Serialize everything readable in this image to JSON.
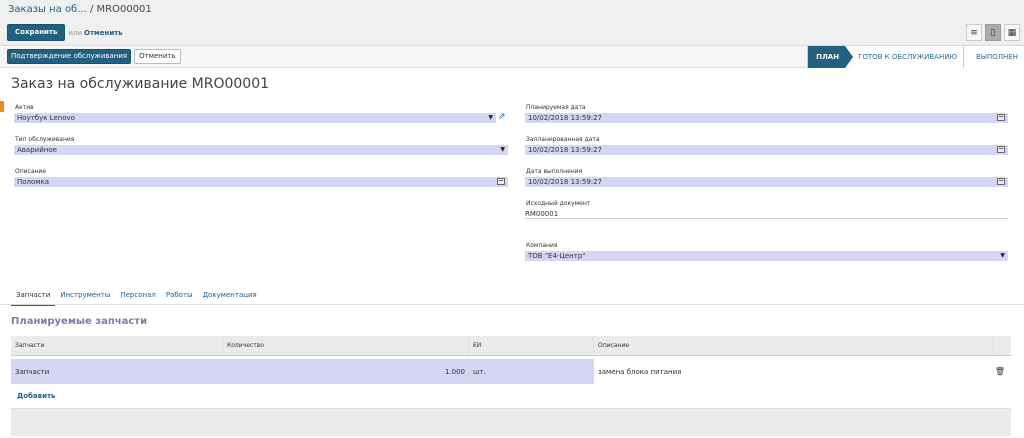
{
  "breadcrumb": {
    "parent": "Заказы на об...",
    "separator": "/",
    "current": "MRO00001"
  },
  "toolbar": {
    "save_label": "Сохранить",
    "or_label": "или",
    "cancel_label": "Отменить"
  },
  "views": [
    "list-view-icon",
    "form-view-icon",
    "calendar-view-icon"
  ],
  "header": {
    "confirm_label": "Подтверждение обслуживания",
    "cancel_label": "Отменить",
    "stages": [
      {
        "label": "ПЛАН",
        "active": true
      },
      {
        "label": "ГОТОВ К ОБСЛУЖИВАНИЮ",
        "active": false
      },
      {
        "label": "ВЫПОЛНЕН",
        "active": false
      }
    ]
  },
  "form": {
    "title": "Заказ на обслуживание MRO00001",
    "asset": {
      "label": "Актив",
      "value": "Ноутбук Lenovo"
    },
    "maintenance_type": {
      "label": "Тип обслуживания",
      "value": "Аварийное"
    },
    "description": {
      "label": "Описание",
      "value": "Поломка"
    },
    "planned_date": {
      "label": "Планируемая дата",
      "value": "10/02/2018 13:59:27"
    },
    "scheduled_date": {
      "label": "Запланированная дата",
      "value": "10/02/2018 13:59:27"
    },
    "execution_date": {
      "label": "Дата выполнения",
      "value": "10/02/2018 13:59:27"
    },
    "source_document": {
      "label": "Исходный документ",
      "value": "RM00001"
    },
    "company": {
      "label": "Компания",
      "value": "ТОВ \"Е4-Центр\""
    }
  },
  "tabs": [
    "Запчасти",
    "Инструменты",
    "Персонал",
    "Работы",
    "Документация"
  ],
  "active_tab": 0,
  "parts_section": {
    "title": "Планируемые запчасти",
    "columns": [
      "Запчасти",
      "Количество",
      "ЕИ",
      "Описание"
    ],
    "rows": [
      {
        "part": "Запчасти",
        "quantity": "1.000",
        "uom": "шт.",
        "description": "замена блока питания"
      }
    ],
    "add_label": "Добавить"
  },
  "colors": {
    "primary": "#21607f",
    "field_bg": "#d5d5f4",
    "section_title": "#7c7bad",
    "accent": "#f08a24"
  }
}
